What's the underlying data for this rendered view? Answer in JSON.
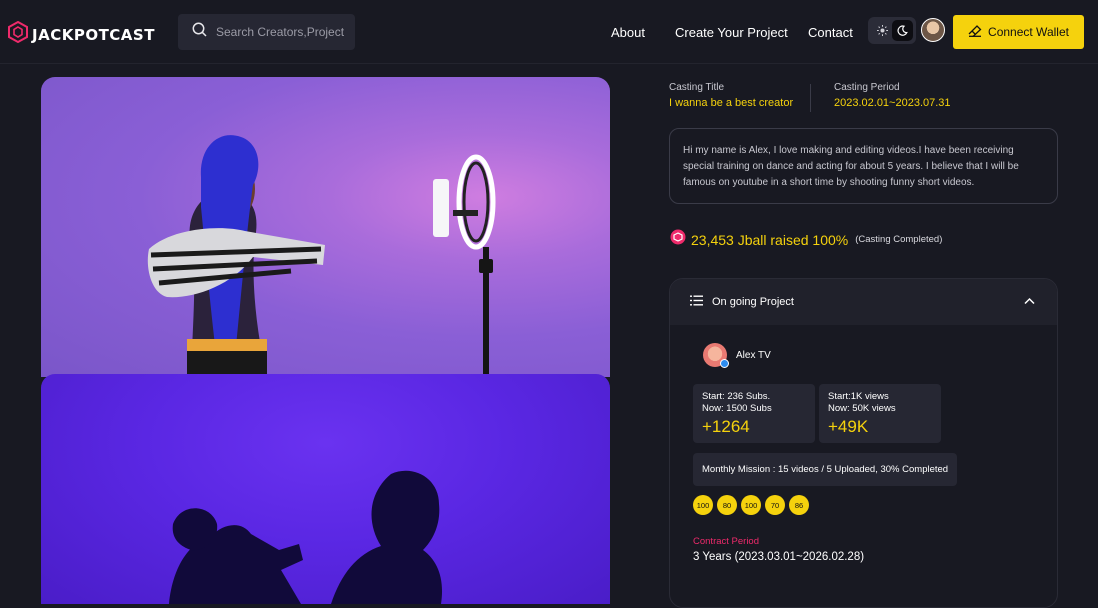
{
  "brand": {
    "name": "JACKPOTCAST"
  },
  "search": {
    "placeholder": "Search Creators,Project etc"
  },
  "nav": {
    "items": [
      "About",
      "Create Your Project",
      "Contact"
    ]
  },
  "theme": {
    "options": [
      "sun-icon",
      "moon-icon"
    ],
    "selected": "dark"
  },
  "wallet": {
    "label": "Connect Wallet"
  },
  "colors": {
    "accent": "#f5d20d",
    "background": "#181922",
    "panel": "#262733",
    "contract_label": "#ee2a6b"
  },
  "casting": {
    "title_label": "Casting Title",
    "title_value": "I wanna be a best creator",
    "period_label": "Casting Period",
    "period_value": "2023.02.01~2023.07.31"
  },
  "bio": "Hi my name is Alex, I love making and editing videos.I have been receiving special training on dance and acting for about 5 years. I believe that I will be famous on youtube in a short time by shooting funny short videos.",
  "raised": {
    "text": "23,453 Jball raised 100%",
    "status": "(Casting Completed)"
  },
  "project": {
    "heading": "On going Project",
    "creator": "Alex TV",
    "stats": [
      {
        "line1": "Start: 236 Subs.",
        "line2": "Now: 1500 Subs",
        "delta": "+1264"
      },
      {
        "line1": "Start:1K views",
        "line2": "Now: 50K views",
        "delta": "+49K"
      }
    ],
    "mission": "Monthly Mission : 15 videos / 5 Uploaded, 30% Completed",
    "scores": [
      "100",
      "80",
      "100",
      "70",
      "86"
    ],
    "contract_label": "Contract Period",
    "contract_value": "3 Years (2023.03.01~2026.02.28)"
  }
}
